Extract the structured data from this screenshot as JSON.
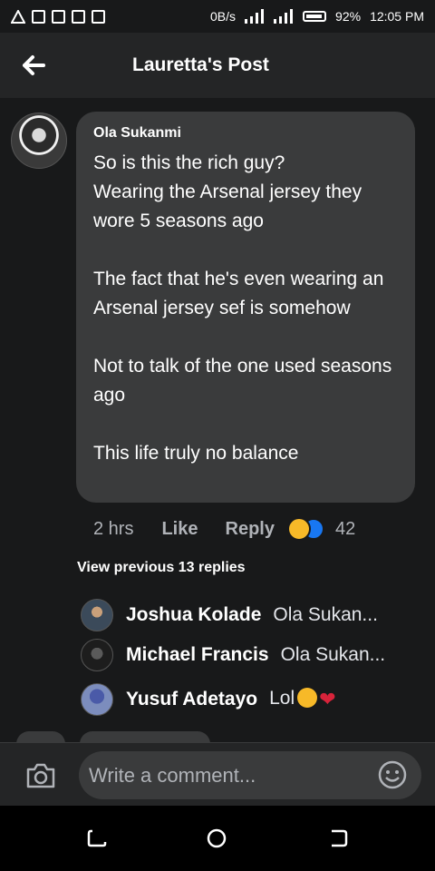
{
  "status_bar": {
    "network_speed": "0B/s",
    "network_type": "3G",
    "battery": "92%",
    "time": "12:05 PM"
  },
  "header": {
    "title": "Lauretta's Post",
    "back_icon": "arrow-left-icon"
  },
  "comment": {
    "author": "Ola Sukanmi",
    "text": "So is this the rich guy?\nWearing the Arsenal jersey they wore 5 seasons ago\n\nThe fact that he's even wearing an Arsenal jersey sef is somehow\n\nNot to talk of the one used seasons ago\n\nThis life truly no balance",
    "time": "2 hrs",
    "like_label": "Like",
    "reply_label": "Reply",
    "reaction_count": "42",
    "reaction_icons": [
      "haha-icon",
      "like-icon"
    ]
  },
  "view_previous": "View previous 13 replies",
  "replies": [
    {
      "name": "Joshua Kolade",
      "text": "Ola Sukan..."
    },
    {
      "name": "Michael Francis",
      "text": "Ola Sukan..."
    },
    {
      "name": "Yusuf Adetayo",
      "text": "Lol"
    }
  ],
  "composer": {
    "placeholder": "Write a comment...",
    "camera_icon": "camera-icon",
    "emoji_icon": "smiley-icon"
  },
  "colors": {
    "background": "#18191a",
    "bubble": "#3a3b3c",
    "header": "#242526",
    "secondary_text": "#b0b3b8"
  }
}
